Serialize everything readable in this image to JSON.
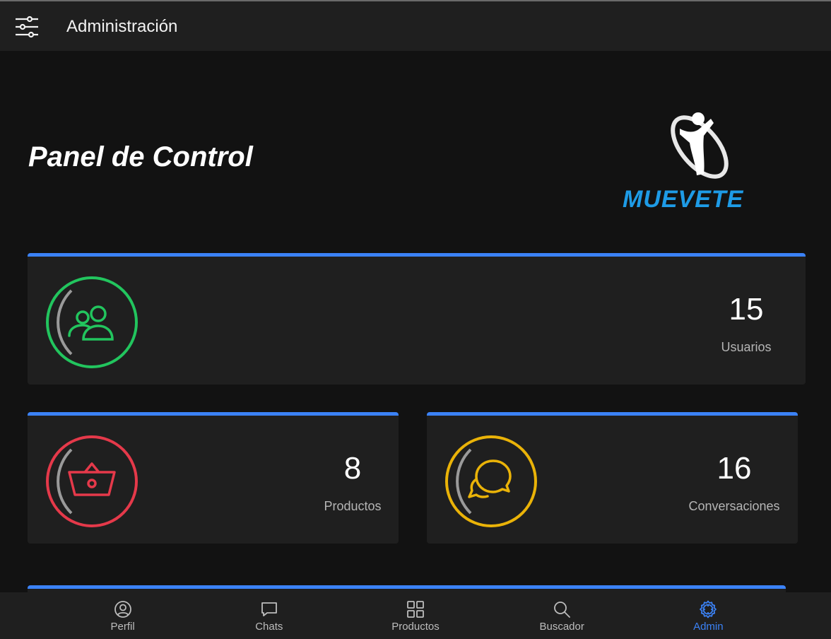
{
  "header": {
    "title": "Administración",
    "menu_icon": "sliders-icon"
  },
  "dashboard": {
    "title": "Panel de Control",
    "logo_text": "MUEVETE"
  },
  "stats": {
    "users": {
      "count": "15",
      "label": "Usuarios",
      "icon": "users-icon",
      "color": "#22c55e"
    },
    "products": {
      "count": "8",
      "label": "Productos",
      "icon": "basket-icon",
      "color": "#e5394a"
    },
    "chats": {
      "count": "16",
      "label": "Conversaciones",
      "icon": "chat-icon",
      "color": "#eab308"
    }
  },
  "accent_color": "#3b82f6",
  "nav": {
    "items": [
      {
        "label": "Perfil",
        "icon": "user-circle-icon"
      },
      {
        "label": "Chats",
        "icon": "message-icon"
      },
      {
        "label": "Productos",
        "icon": "grid-icon"
      },
      {
        "label": "Buscador",
        "icon": "search-icon"
      },
      {
        "label": "Admin",
        "icon": "gear-icon",
        "active": true
      }
    ]
  }
}
